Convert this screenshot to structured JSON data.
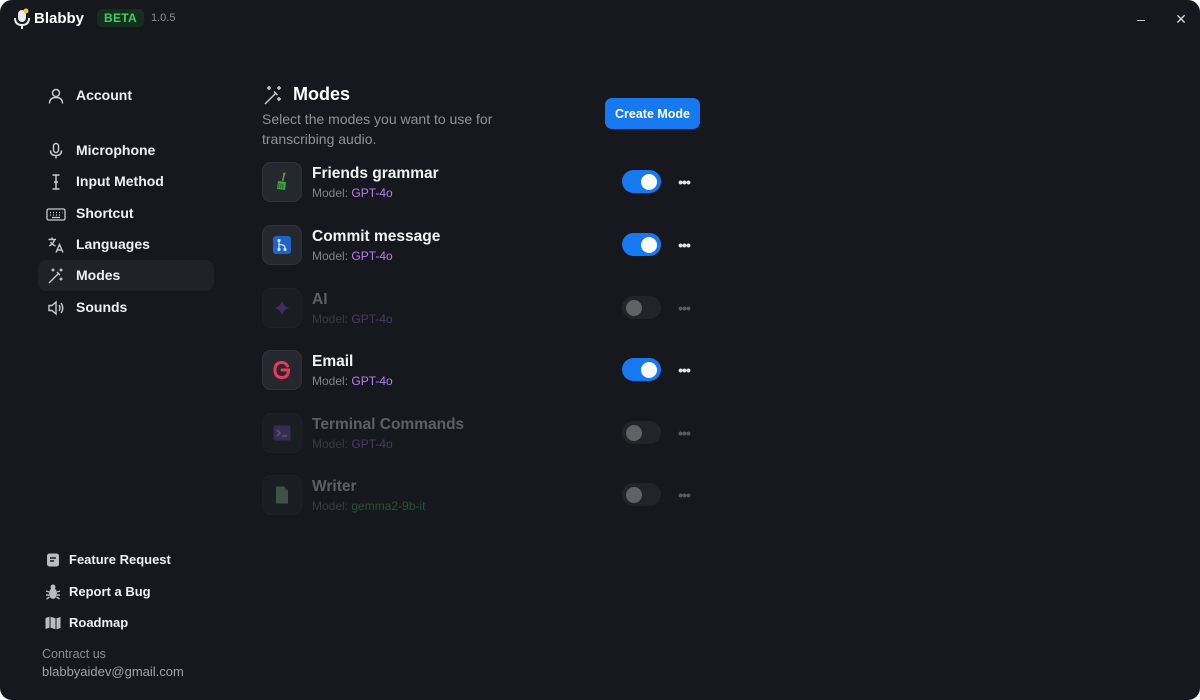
{
  "titlebar": {
    "app_name": "Blabby",
    "badge": "BETA",
    "version": "1.0.5",
    "minimize": "–",
    "close": "✕"
  },
  "sidebar": {
    "items": [
      {
        "label": "Account",
        "icon": "user-icon"
      },
      {
        "label": "Microphone",
        "icon": "microphone-icon"
      },
      {
        "label": "Input Method",
        "icon": "text-cursor-icon"
      },
      {
        "label": "Shortcut",
        "icon": "keyboard-icon"
      },
      {
        "label": "Languages",
        "icon": "translate-icon"
      },
      {
        "label": "Modes",
        "icon": "magic-wand-icon",
        "active": true
      },
      {
        "label": "Sounds",
        "icon": "speaker-icon"
      }
    ],
    "footer": [
      {
        "label": "Feature Request",
        "icon": "note-icon"
      },
      {
        "label": "Report a Bug",
        "icon": "bug-icon"
      },
      {
        "label": "Roadmap",
        "icon": "map-icon"
      }
    ],
    "contact_label": "Contract us",
    "contact_email": "blabbyaidev@gmail.com"
  },
  "main": {
    "title": "Modes",
    "subtitle": "Select the modes you want to use for transcribing audio.",
    "create_button": "Create Mode",
    "modes": [
      {
        "name": "Friends grammar",
        "model_prefix": "Model:",
        "model": "GPT-4o",
        "enabled": true,
        "icon": "broom-icon",
        "model_color": "#b57ff0"
      },
      {
        "name": "Commit message",
        "model_prefix": "Model:",
        "model": "GPT-4o",
        "enabled": true,
        "icon": "git-branch-icon",
        "model_color": "#b57ff0"
      },
      {
        "name": "AI",
        "model_prefix": "Model:",
        "model": "GPT-4o",
        "enabled": false,
        "icon": "ai-sparkle-icon",
        "model_color": "#b57ff0"
      },
      {
        "name": "Email",
        "model_prefix": "Model:",
        "model": "GPT-4o",
        "enabled": true,
        "icon": "gmail-icon",
        "model_color": "#b57ff0"
      },
      {
        "name": "Terminal Commands",
        "model_prefix": "Model:",
        "model": "GPT-4o",
        "enabled": false,
        "icon": "terminal-icon",
        "model_color": "#b57ff0"
      },
      {
        "name": "Writer",
        "model_prefix": "Model:",
        "model": "gemma2-9b-it",
        "enabled": false,
        "icon": "document-icon",
        "model_color": "#3fcf6a"
      }
    ],
    "more_label": "•••"
  },
  "colors": {
    "accent": "#1779ef",
    "background": "#16181d",
    "badge_green": "#3fcf6a"
  }
}
